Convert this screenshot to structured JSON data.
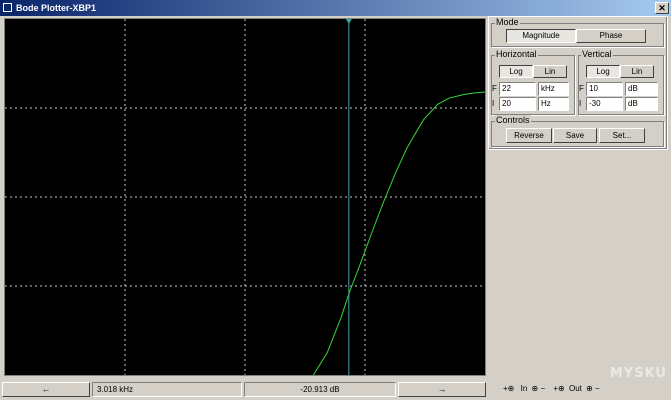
{
  "window": {
    "title": "Bode Plotter-XBP1",
    "close_glyph": "✕"
  },
  "mode": {
    "title": "Mode",
    "magnitude_label": "Magnitude",
    "phase_label": "Phase",
    "selected": "Magnitude"
  },
  "horizontal": {
    "title": "Horizontal",
    "log_label": "Log",
    "lin_label": "Lin",
    "selected": "Log",
    "f_letter": "F",
    "f_value": "22",
    "f_unit": "kHz",
    "i_letter": "I",
    "i_value": "20",
    "i_unit": "Hz"
  },
  "vertical": {
    "title": "Vertical",
    "log_label": "Log",
    "lin_label": "Lin",
    "selected": "Log",
    "f_letter": "F",
    "f_value": "10",
    "f_unit": "dB",
    "i_letter": "I",
    "i_value": "-30",
    "i_unit": "dB"
  },
  "controls": {
    "title": "Controls",
    "reverse_label": "Reverse",
    "save_label": "Save",
    "set_label": "Set..."
  },
  "status": {
    "left_arrow": "←",
    "right_arrow": "→",
    "frequency_readout": "3.018 kHz",
    "gain_readout": "-20.913 dB"
  },
  "terminals": {
    "in_label": "In",
    "out_label": "Out"
  },
  "watermark": "MYSKU",
  "colors": {
    "trace": "#39d639",
    "cursor": "#3fa6a6",
    "grid": "#c8c8c8",
    "background": "#000000"
  },
  "chart_data": {
    "type": "line",
    "x_scale": "log",
    "xlim": [
      20,
      22000
    ],
    "y_scale": "linear",
    "ylim": [
      -30,
      10
    ],
    "x_unit": "Hz",
    "y_unit": "dB",
    "grid": true,
    "series": [
      {
        "x": [
          1800,
          2200,
          2700,
          3018,
          3500,
          4200,
          5000,
          6000,
          7000,
          8000,
          9000,
          11000,
          13000,
          16000,
          19000,
          22000
        ],
        "y": [
          -30.0,
          -27.5,
          -23.5,
          -20.9,
          -17.9,
          -14.1,
          -10.6,
          -7.2,
          -4.6,
          -2.8,
          -1.3,
          0.4,
          1.1,
          1.5,
          1.7,
          1.8
        ]
      }
    ],
    "cursor": {
      "x": 3018,
      "y": -20.913
    }
  }
}
